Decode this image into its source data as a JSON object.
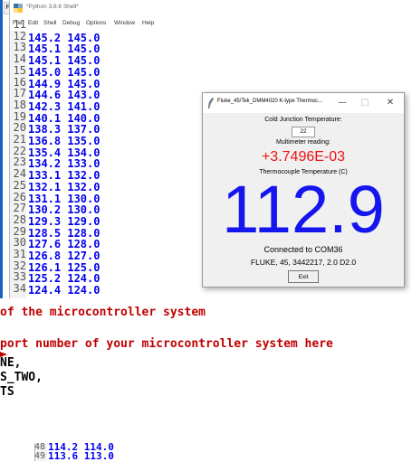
{
  "background": {
    "file_tab": "File",
    "code_lines": [
      "of the microcontroller system",
      "port number of your microcontroller system here",
      "NE,",
      "S_TWO,",
      "TS"
    ],
    "bottom_lines": [
      {
        "num": "48",
        "text": "114.2 114.0"
      },
      {
        "num": "49",
        "text": "113.6 113.0"
      }
    ]
  },
  "shell": {
    "title": "*Python 3.8.6 Shell*",
    "menu": [
      "File",
      "Edit",
      "Shell",
      "Debug",
      "Options",
      "Window",
      "Help"
    ],
    "lines": [
      {
        "num": "11",
        "text": ""
      },
      {
        "num": "12",
        "text": "145.2 145.0"
      },
      {
        "num": "13",
        "text": "145.1 145.0"
      },
      {
        "num": "14",
        "text": "145.1 145.0"
      },
      {
        "num": "15",
        "text": "145.0 145.0"
      },
      {
        "num": "16",
        "text": "144.9 145.0"
      },
      {
        "num": "17",
        "text": "144.6 143.0"
      },
      {
        "num": "18",
        "text": "142.3 141.0"
      },
      {
        "num": "19",
        "text": "140.1 140.0"
      },
      {
        "num": "20",
        "text": "138.3 137.0"
      },
      {
        "num": "21",
        "text": "136.8 135.0"
      },
      {
        "num": "22",
        "text": "135.4 134.0"
      },
      {
        "num": "23",
        "text": "134.2 133.0"
      },
      {
        "num": "24",
        "text": "133.1 132.0"
      },
      {
        "num": "25",
        "text": "132.1 132.0"
      },
      {
        "num": "26",
        "text": "131.1 130.0"
      },
      {
        "num": "27",
        "text": "130.2 130.0"
      },
      {
        "num": "28",
        "text": "129.3 129.0"
      },
      {
        "num": "29",
        "text": "128.5 128.0"
      },
      {
        "num": "30",
        "text": "127.6 128.0"
      },
      {
        "num": "31",
        "text": "126.8 127.0"
      },
      {
        "num": "32",
        "text": "126.1 125.0"
      },
      {
        "num": "33",
        "text": "125.2 124.0"
      },
      {
        "num": "34",
        "text": "124.4 124.0"
      }
    ]
  },
  "popup": {
    "title": "Fluke_45/Tek_DMM4020 K-type Thermoc...",
    "minimize": "—",
    "maximize": "□",
    "close": "✕",
    "cold_junction_label": "Cold Junction Temperature:",
    "cold_junction_value": "22",
    "multimeter_label": "Multimeter reading:",
    "multimeter_value": "+3.7496E-03",
    "thermocouple_label": "Thermocouple Temperature (C)",
    "temperature": "112.9",
    "connection": "Connected to COM36",
    "identity": "FLUKE, 45, 3442217, 2.0 D2.0",
    "exit_label": "Exit"
  },
  "colors": {
    "shell_text": "#0000ee",
    "code_red": "#c00000",
    "multimeter_red": "#ee1111",
    "temperature_blue": "#1515ee"
  }
}
